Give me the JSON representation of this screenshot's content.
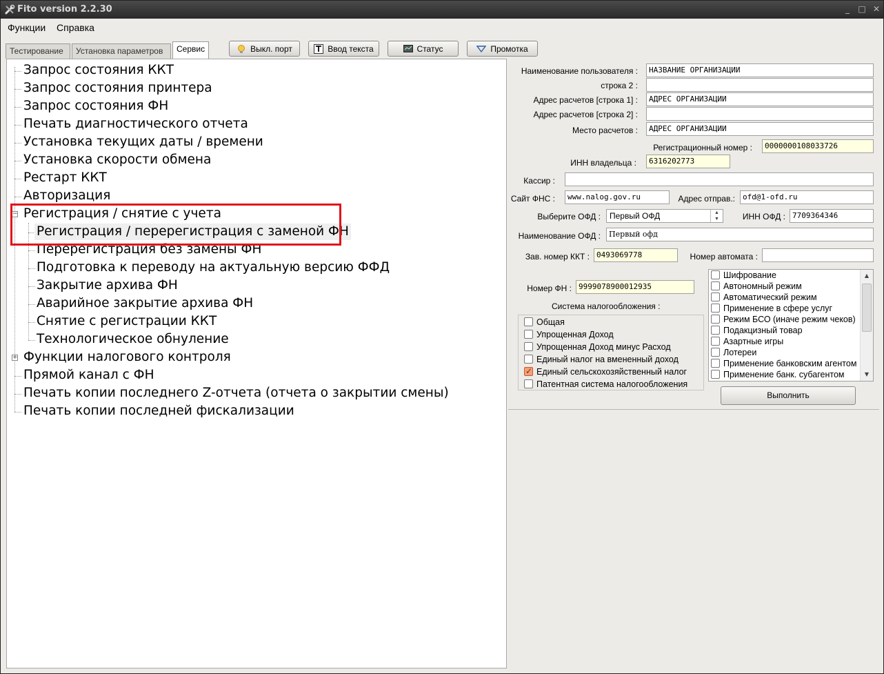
{
  "window": {
    "title": "Fito version 2.2.30",
    "controls": [
      "_",
      "□",
      "✕"
    ]
  },
  "menu": [
    "Функции",
    "Справка"
  ],
  "tabs": [
    "Тестирование",
    "Установка параметров",
    "Сервис"
  ],
  "toolbar": {
    "port": "Выкл. порт",
    "text": "Ввод текста",
    "status": "Статус",
    "feed": "Промотка"
  },
  "tree": [
    "Запрос состояния ККТ",
    "Запрос состояния принтера",
    "Запрос состояния ФН",
    "Печать диагностического отчета",
    "Установка текущих даты / времени",
    "Установка скорости обмена",
    "Рестарт ККТ",
    "Авторизация",
    "Регистрация / снятие с учета",
    "Регистрация / перерегистрация с заменой ФН",
    "Перерегистрация без замены ФН",
    "Подготовка к переводу на актуальную версию ФФД",
    "Закрытие архива ФН",
    "Аварийное закрытие архива ФН",
    "Снятие с регистрации ККТ",
    "Технологическое обнуление",
    "Функции налогового контроля",
    "Прямой канал с ФН",
    "Печать копии последнего Z-отчета (отчета о закрытии смены)",
    "Печать копии последней фискализации"
  ],
  "form": {
    "user_name_label": "Наименование пользователя :",
    "user_name": "НАЗВАНИЕ ОРГАНИЗАЦИИ",
    "line2_label": "строка 2 :",
    "line2": "",
    "addr1_label": "Адрес расчетов [строка 1] :",
    "addr1": "АДРЕС ОРГАНИЗАЦИИ",
    "addr2_label": "Адрес расчетов [строка 2] :",
    "addr2": "",
    "place_label": "Место расчетов :",
    "place": "АДРЕС ОРГАНИЗАЦИИ",
    "regnum_label": "Регистрационный номер :",
    "regnum": "0000000108033726",
    "inn_owner_label": "ИНН владельца :",
    "inn_owner": "6316202773",
    "cashier_label": "Кассир  :",
    "cashier": "",
    "fns_site_label": "Сайт ФНС :",
    "fns_site": "www.nalog.gov.ru",
    "sender_label": "Адрес отправ.:",
    "sender": "ofd@1-ofd.ru",
    "ofd_select_label": "Выберите ОФД :",
    "ofd_select": "Первый ОФД",
    "inn_ofd_label": "ИНН ОФД :",
    "inn_ofd": "7709364346",
    "ofd_name_label": "Наименование ОФД :",
    "ofd_name": "Первый офд",
    "kkt_num_label": "Зав. номер ККТ :",
    "kkt_num": "0493069778",
    "automat_label": "Номер автомата :",
    "automat": "",
    "fn_num_label": "Номер ФН :",
    "fn_num": "9999078900012935",
    "tax_label": "Система  налогообложения :"
  },
  "tax_systems": [
    {
      "label": "Общая",
      "checked": false
    },
    {
      "label": "Упрощенная Доход",
      "checked": false
    },
    {
      "label": "Упрощенная Доход минус Расход",
      "checked": false
    },
    {
      "label": "Единый налог на вмененный доход",
      "checked": false
    },
    {
      "label": "Единый сельскохозяйственный налог",
      "checked": true
    },
    {
      "label": "Патентная система налогообложения",
      "checked": false
    }
  ],
  "modes": [
    {
      "label": "Шифрование",
      "checked": false
    },
    {
      "label": "Автономный режим",
      "checked": false
    },
    {
      "label": "Автоматический режим",
      "checked": false
    },
    {
      "label": "Применение в сфере услуг",
      "checked": false
    },
    {
      "label": "Режим БСО (иначе режим чеков)",
      "checked": false
    },
    {
      "label": "Подакцизный товар",
      "checked": false
    },
    {
      "label": "Азартные игры",
      "checked": false
    },
    {
      "label": "Лотереи",
      "checked": false
    },
    {
      "label": "Применение банковским агентом",
      "checked": false
    },
    {
      "label": "Применение банк. субагентом",
      "checked": false
    }
  ],
  "execute": "Выполнить"
}
